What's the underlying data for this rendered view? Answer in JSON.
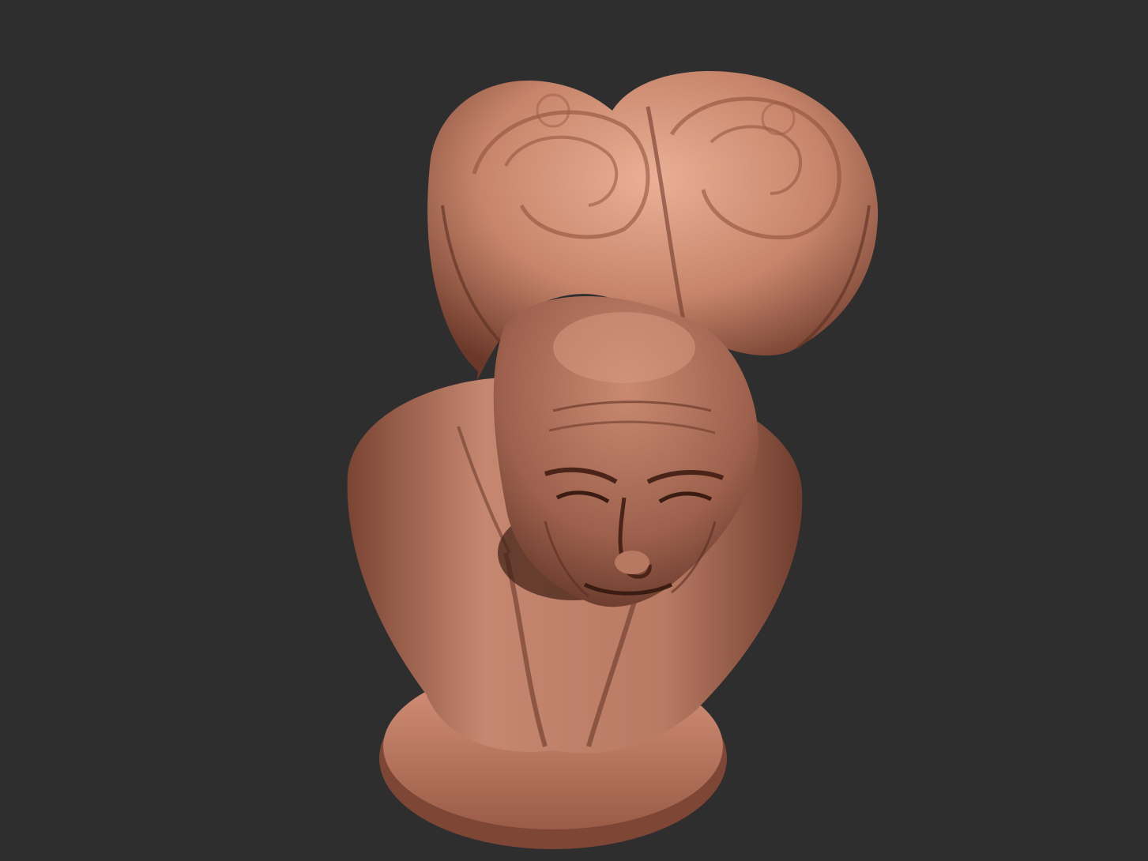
{
  "viewport": {
    "background_color": "#2e2e2e",
    "subject": "sculpted-bust"
  },
  "model": {
    "material_color": "#c9846c",
    "shadow_color": "#6b3a2a",
    "highlight_color": "#e6a58a"
  }
}
